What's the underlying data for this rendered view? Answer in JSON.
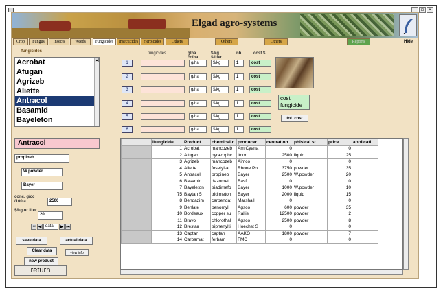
{
  "window": {
    "buttons": [
      "_",
      "▫",
      "×"
    ]
  },
  "banner": {
    "title": "Elgad agro-systems"
  },
  "tabs": [
    {
      "label": "Crop"
    },
    {
      "label": "Fungus"
    },
    {
      "label": "Insects"
    },
    {
      "label": "Weeds"
    },
    {
      "label": "Fungicides"
    },
    {
      "label": "Insecticides"
    },
    {
      "label": "Herbicides"
    },
    {
      "label": "Others"
    },
    {
      "label": "Others"
    },
    {
      "label": "Others"
    },
    {
      "label": "Reports"
    }
  ],
  "hide_label": "Hide",
  "fungicides_panel": {
    "heading": "fungicides",
    "items": [
      "Acrobat",
      "Afugan",
      "Agrizeb",
      "Aliette",
      "Antracol",
      "Basamid",
      "Bayeleton"
    ],
    "selected_index": 4,
    "selected_value": "Antracol"
  },
  "details": {
    "chemical": "propineb",
    "formulation": "W.powder",
    "producer": "Bayer",
    "conc_label": "conc. g/cc /100la",
    "conc_value": "2500",
    "price_label": "$/kg or liter",
    "price_value": "20",
    "nav_data": "data"
  },
  "buttons": {
    "save_data": "save data",
    "actual_data": "actual data",
    "clear_data": "Clear data",
    "view_info": "view info",
    "new_product": "new product",
    "return": "return",
    "tot_cost": "tot. cost"
  },
  "rows_header": {
    "fungicides": "fungicides",
    "gha": "g/ha cc/ha",
    "skg": "$/kg $/liter",
    "nb": "nb",
    "cost": "cost $"
  },
  "cost_rows": [
    {
      "num": "1",
      "unit1": "g/ha",
      "unit2": "$/kg",
      "nb": "1",
      "cost": "cost"
    },
    {
      "num": "2",
      "unit1": "g/ha",
      "unit2": "$/kg",
      "nb": "1",
      "cost": "cost"
    },
    {
      "num": "3",
      "unit1": "g/ha",
      "unit2": "$/kg",
      "nb": "1",
      "cost": "cost"
    },
    {
      "num": "4",
      "unit1": "g/ha",
      "unit2": "$/kg",
      "nb": "1",
      "cost": "cost"
    },
    {
      "num": "5",
      "unit1": "g/ha",
      "unit2": "$/kg",
      "nb": "1",
      "cost": "cost"
    },
    {
      "num": "6",
      "unit1": "g/ha",
      "unit2": "$/kg",
      "nb": "1",
      "cost": "cost"
    }
  ],
  "cost_total": "cost fungicide",
  "table": {
    "columns": [
      "",
      "ifungicide",
      "Product",
      "chemical c",
      "producer",
      "centration",
      "phisical st",
      "price",
      "applicati"
    ],
    "rows": [
      [
        "",
        "1",
        "Acrobat",
        "mancozeb",
        "Am.Cyana",
        "0",
        "",
        "0",
        ""
      ],
      [
        "",
        "2",
        "Afugan",
        "pyrazophc",
        "Itcon",
        "2500",
        "liquid",
        "25",
        ""
      ],
      [
        "",
        "3",
        "Agrizeb",
        "mancozeb",
        "Aimco",
        "0",
        "",
        "0",
        ""
      ],
      [
        "",
        "4",
        "Aliette",
        "fosetyl-al",
        "Rhone Po",
        "3750",
        "powder",
        "35",
        ""
      ],
      [
        "",
        "5",
        "Antracol",
        "propineb",
        "Bayer",
        "2500",
        "W.powder",
        "20",
        ""
      ],
      [
        "",
        "6",
        "Basamid",
        "dazomet",
        "Basf",
        "0",
        "",
        "0",
        ""
      ],
      [
        "",
        "7",
        "Bayeleton",
        "triadimefo",
        "Bayer",
        "1000",
        "W.powder",
        "10",
        ""
      ],
      [
        "",
        "75",
        "Baytan 5",
        "tridimeton",
        "Bayer",
        "2000",
        "liquid",
        "15",
        ""
      ],
      [
        "",
        "8",
        "Bendazim",
        "carbenda:",
        "Marshall",
        "0",
        "",
        "0",
        ""
      ],
      [
        "",
        "9",
        "Benlate",
        "benomyl",
        "Agsco",
        "600",
        "powder",
        "35",
        ""
      ],
      [
        "",
        "10",
        "Bordeaux",
        "copper su",
        "Rallis",
        "12500",
        "powder",
        "2",
        ""
      ],
      [
        "",
        "11",
        "Bravo",
        "chlorothal",
        "Agsco",
        "2500",
        "powder",
        "8",
        ""
      ],
      [
        "",
        "12",
        "Brestan",
        "triphenylti",
        "Hoechst S",
        "0",
        "",
        "0",
        ""
      ],
      [
        "",
        "13",
        "Captan",
        "captan",
        "AAKO",
        "1800",
        "powder",
        "7",
        ""
      ],
      [
        "",
        "14",
        "Carbamat",
        "ferbam",
        "FMC",
        "0",
        "",
        "0",
        ""
      ]
    ]
  }
}
